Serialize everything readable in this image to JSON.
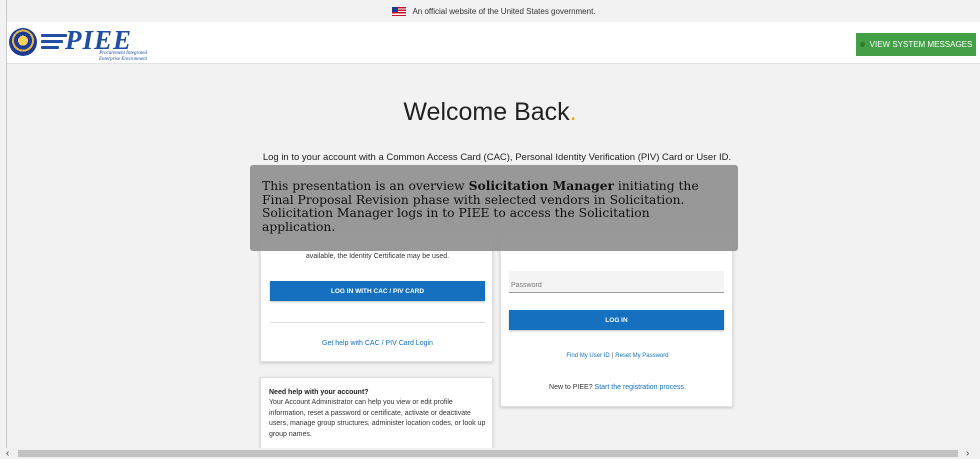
{
  "gov_banner": {
    "text": "An official website of the United States government."
  },
  "header": {
    "logo_text": "PIEE",
    "logo_subtitle_1": "Procurement Integrated",
    "logo_subtitle_2": "Enterprise Environment",
    "system_messages_button": "VIEW SYSTEM MESSAGES"
  },
  "main": {
    "welcome_title": "Welcome Back",
    "welcome_dot": ".",
    "intro": "Log in to your account with a Common Access Card (CAC), Personal Identity Verification (PIV) Card or User ID."
  },
  "cac_card": {
    "text": "available, the Identity Certificate may be used.",
    "login_button": "LOG IN WITH CAC / PIV CARD",
    "help_link": "Get help with CAC / PIV Card Login"
  },
  "userid_card": {
    "password_placeholder": "Password",
    "login_button": "LOG IN",
    "find_user_id_link": "Find My User ID",
    "separator": "|",
    "reset_password_link": "Reset My Password",
    "new_prefix": "New to PIEE?",
    "registration_link": "Start the registration process."
  },
  "help_card": {
    "title": "Need help with your account?",
    "body": "Your Account Administrator can help you view or edit profile information, reset a password or certificate, activate or deactivate users, manage group structures, administer location codes, or look up group names."
  },
  "overlay": {
    "text_1": "This presentation is an overview ",
    "bold_1": "Solicitation Manager",
    "text_2": " initiating the Final Proposal Revision phase with selected vendors in Solicitation. Solicitation Manager logs in to PIEE to access the Solicitation application."
  },
  "scrollbar": {
    "left_arrow": "‹",
    "right_arrow": "›"
  },
  "colors": {
    "brand_blue": "#1670c0",
    "accent_green": "#43a047",
    "welcome_dot": "#f0a81a"
  }
}
